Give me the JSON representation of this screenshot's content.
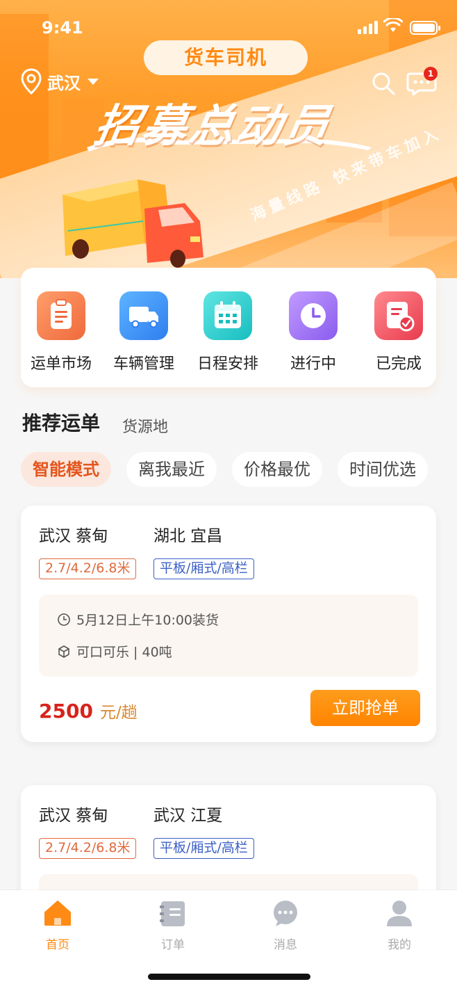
{
  "status_bar": {
    "time": "9:41"
  },
  "banner": {
    "pill_text": "货车司机",
    "location": "武汉",
    "slogan": "招募总动员",
    "diagonal_left": "海量线路",
    "diagonal_right": "快来带车加入",
    "message_badge": "1"
  },
  "quick_entries": [
    {
      "label": "运单市场",
      "icon": "clipboard-icon",
      "color": "#f27b4f"
    },
    {
      "label": "车辆管理",
      "icon": "truck-icon",
      "color": "#2f8ff5"
    },
    {
      "label": "日程安排",
      "icon": "calendar-icon",
      "color": "#23c6c9"
    },
    {
      "label": "进行中",
      "icon": "clock-icon",
      "color": "#9b6ff0"
    },
    {
      "label": "已完成",
      "icon": "document-check-icon",
      "color": "#ee4d5d"
    }
  ],
  "section": {
    "title": "推荐运单",
    "subtitle": "货源地",
    "filters": [
      "智能模式",
      "离我最近",
      "价格最优",
      "时间优选"
    ],
    "active_filter": "智能模式"
  },
  "orders": [
    {
      "from": "武汉 蔡甸",
      "to": "湖北 宜昌",
      "size_tag": "2.7/4.2/6.8米",
      "type_tag": "平板/厢式/高栏",
      "load_time": "5月12日上午10:00装货",
      "cargo": "可口可乐 |  40吨",
      "price": "2500",
      "price_unit": "元/趟",
      "action": "立即抢单"
    },
    {
      "from": "武汉 蔡甸",
      "to": "武汉 江夏",
      "size_tag": "2.7/4.2/6.8米",
      "type_tag": "平板/厢式/高栏"
    }
  ],
  "tabbar": [
    {
      "label": "首页",
      "icon": "home-icon",
      "active": true
    },
    {
      "label": "订单",
      "icon": "order-icon",
      "active": false
    },
    {
      "label": "消息",
      "icon": "message-icon",
      "active": false
    },
    {
      "label": "我的",
      "icon": "profile-icon",
      "active": false
    }
  ],
  "colors": {
    "accent": "#ff8a14",
    "price": "#d7231b",
    "size_tag": "#e06a3c",
    "type_tag": "#3a5fc6"
  }
}
